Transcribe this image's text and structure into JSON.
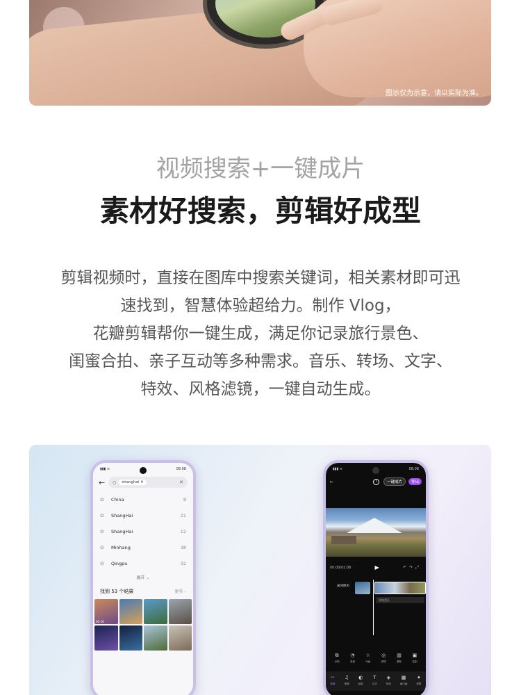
{
  "hero": {
    "disclaimer": "图示仅为示意，请以实际为准。"
  },
  "section": {
    "subtitle": "视频搜索+一键成片",
    "title": "素材好搜索，剪辑好成型",
    "description_lines": [
      "剪辑视频时，直接在图库中搜索关键词，相关素材即可迅",
      "速找到，智慧体验超给力。制作 Vlog，",
      "花瓣剪辑帮你一键生成，满足你记录旅行景色、",
      "闺蜜合拍、亲子互动等多种需求。音乐、转场、文字、",
      "特效、风格滤镜，一键自动生成。"
    ]
  },
  "phone_gallery": {
    "status_time": "08:08",
    "search_chip": "shanghai",
    "locations": [
      {
        "name": "China",
        "count": "8"
      },
      {
        "name": "ShangHai",
        "count": "21"
      },
      {
        "name": "ShangHai",
        "count": "12"
      },
      {
        "name": "Minhang",
        "count": "38"
      },
      {
        "name": "Qingpu",
        "count": "32"
      }
    ],
    "expand": "展开",
    "results": "找到 53 个结果",
    "more": "更多",
    "thumb_times": [
      "00:16",
      "",
      "",
      "",
      "",
      "",
      "",
      ""
    ]
  },
  "phone_editor": {
    "status_time": "08:08",
    "onekey": "一键成片",
    "export": "导出",
    "timecode": "00:00/02:06",
    "track_label": "关闭原声",
    "music_label": "添加音乐",
    "tools_row": [
      {
        "icon": "⧉",
        "label": "分割"
      },
      {
        "icon": "◔",
        "label": "变速"
      },
      {
        "icon": "☆",
        "label": "动画"
      },
      {
        "icon": "◎",
        "label": "滤镜"
      },
      {
        "icon": "▥",
        "label": "删除"
      },
      {
        "icon": "▣",
        "label": "复制"
      }
    ],
    "bottom_tabs": [
      {
        "icon": "✂",
        "label": "剪辑"
      },
      {
        "icon": "♫",
        "label": "音频"
      },
      {
        "icon": "◐",
        "label": "贴纸"
      },
      {
        "icon": "T",
        "label": "文字"
      },
      {
        "icon": "◈",
        "label": "特效"
      },
      {
        "icon": "▦",
        "label": "画中画"
      },
      {
        "icon": "✦",
        "label": "滤镜"
      }
    ]
  }
}
